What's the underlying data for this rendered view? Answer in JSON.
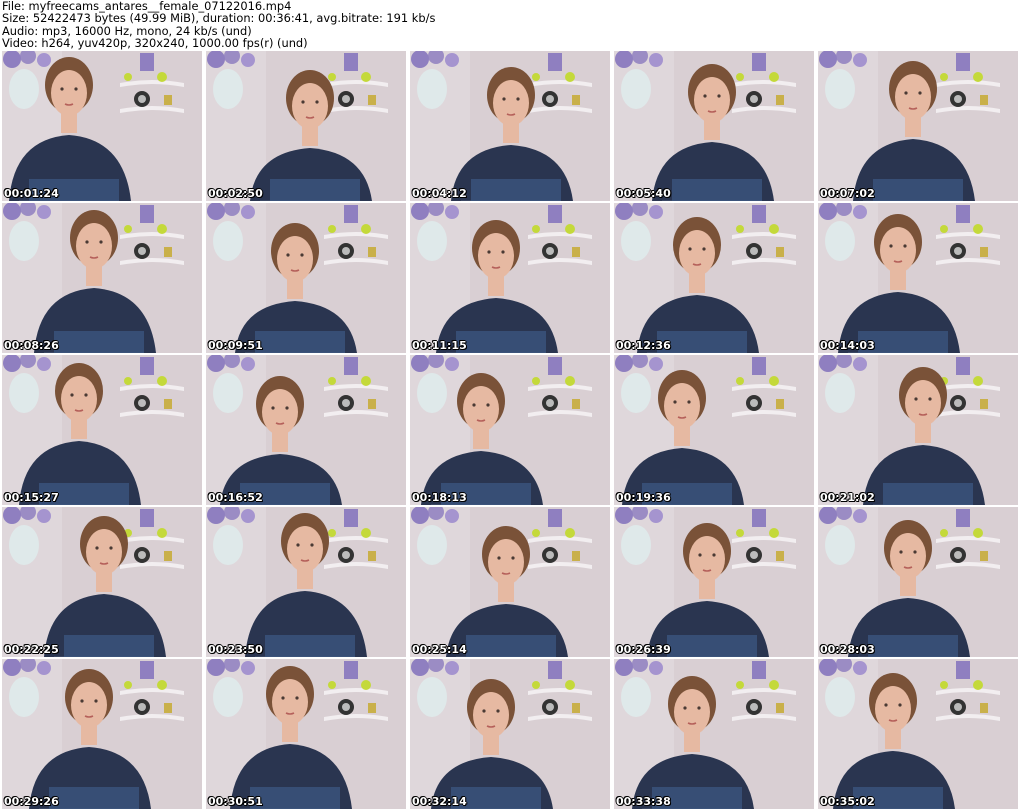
{
  "header": {
    "file": "File: myfreecams_antares__female_07122016.mp4",
    "size": "Size: 52422473 bytes (49.99 MiB), duration: 00:36:41, avg.bitrate: 191 kb/s",
    "audio": "Audio: mp3, 16000 Hz, mono, 24 kb/s (und)",
    "video": "Video: h264, yuv420p, 320x240, 1000.00 fps(r) (und)"
  },
  "colors": {
    "wall": "#d9cfd3",
    "shirt": "#2a3550",
    "hair": "#7a5238",
    "skin": "#e6b9a2",
    "lavender": "#8f7fc0",
    "lime": "#c4d93a",
    "vase": "#dfe9ea",
    "jeans": "#3d5a85"
  },
  "thumbnails": [
    {
      "time": "00:01:24"
    },
    {
      "time": "00:02:50"
    },
    {
      "time": "00:04:12"
    },
    {
      "time": "00:05:40"
    },
    {
      "time": "00:07:02"
    },
    {
      "time": "00:08:26"
    },
    {
      "time": "00:09:51"
    },
    {
      "time": "00:11:15"
    },
    {
      "time": "00:12:36"
    },
    {
      "time": "00:14:03"
    },
    {
      "time": "00:15:27"
    },
    {
      "time": "00:16:52"
    },
    {
      "time": "00:18:13"
    },
    {
      "time": "00:19:36"
    },
    {
      "time": "00:21:02"
    },
    {
      "time": "00:22:25"
    },
    {
      "time": "00:23:50"
    },
    {
      "time": "00:25:14"
    },
    {
      "time": "00:26:39"
    },
    {
      "time": "00:28:03"
    },
    {
      "time": "00:29:26"
    },
    {
      "time": "00:30:51"
    },
    {
      "time": "00:32:14"
    },
    {
      "time": "00:33:38"
    },
    {
      "time": "00:35:02"
    }
  ]
}
